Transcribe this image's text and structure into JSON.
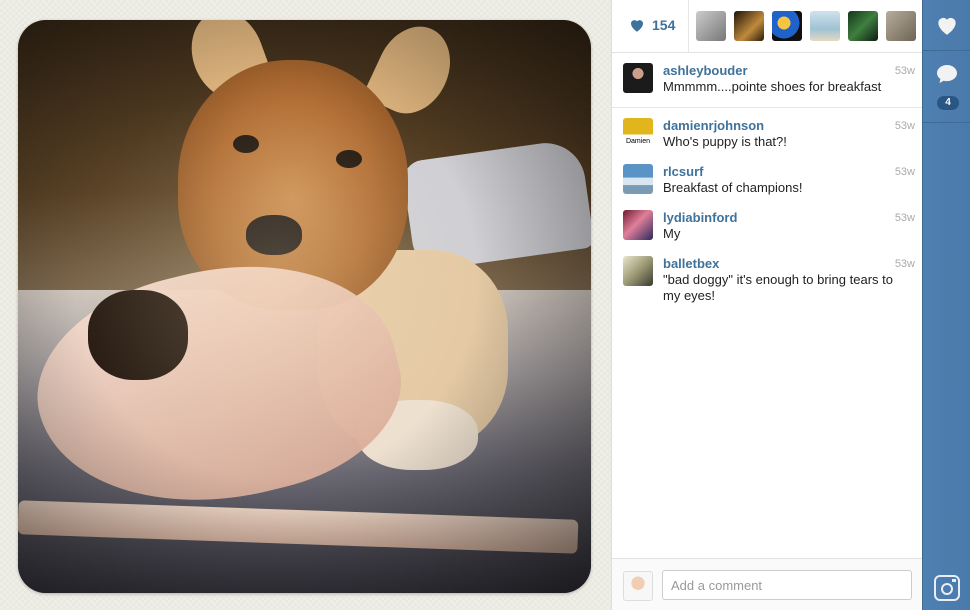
{
  "photo": {
    "subject": ""
  },
  "likes": {
    "count": "154"
  },
  "likers": [
    {
      "name": "liker-1",
      "color": "#a7a7a7"
    },
    {
      "name": "liker-2",
      "color": "#6a4a22"
    },
    {
      "name": "liker-3",
      "color": "#2c6fc6"
    },
    {
      "name": "liker-4",
      "color": "#8fb5c9"
    },
    {
      "name": "liker-5",
      "color": "#3a6d3a"
    },
    {
      "name": "liker-6",
      "color": "#8a8070"
    }
  ],
  "caption": {
    "user": "ashleybouder",
    "text": "Mmmmm....pointe shoes for breakfast",
    "age": "53w"
  },
  "comments": [
    {
      "user": "damienrjohnson",
      "text": "Who's puppy is that?!",
      "age": "53w",
      "avatar_label": "Damien"
    },
    {
      "user": "rlcsurf",
      "text": "Breakfast of champions!",
      "age": "53w"
    },
    {
      "user": "lydiabinford",
      "text": "My",
      "age": "53w"
    },
    {
      "user": "balletbex",
      "text": "\"bad doggy\" it's enough to bring tears to my eyes!",
      "age": "53w"
    }
  ],
  "comment_input": {
    "placeholder": "Add a comment",
    "value": ""
  },
  "rail": {
    "comment_count": "4"
  },
  "colors": {
    "link": "#3f729b",
    "rail": "#4d7eb0"
  }
}
